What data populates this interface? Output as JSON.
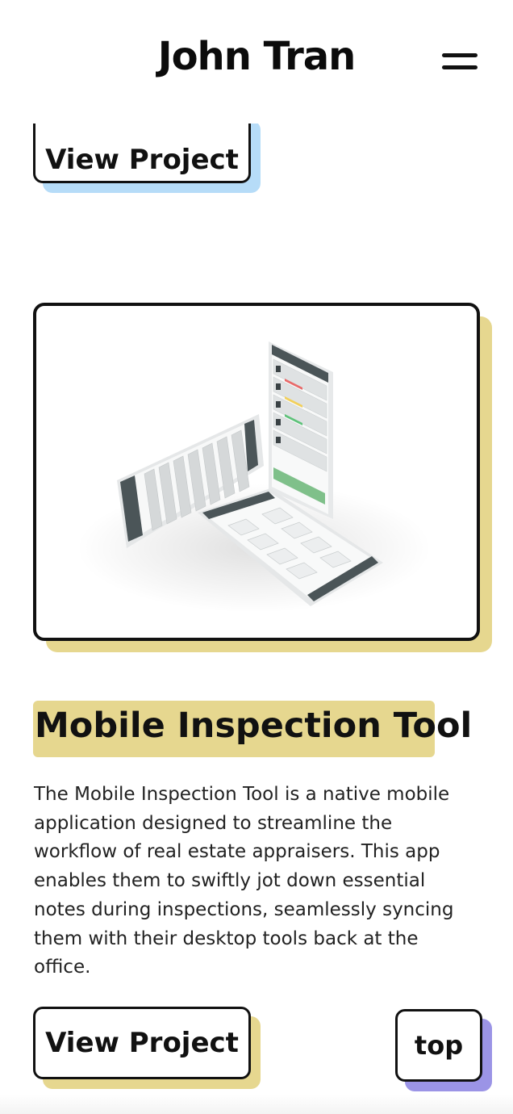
{
  "header": {
    "title": "John Tran",
    "menu_icon": "hamburger-menu-icon"
  },
  "previous_project": {
    "view_label": "View Project",
    "accent": "#b6dcf8"
  },
  "project": {
    "title": "Mobile Inspection Tool",
    "accent": "#e6d78f",
    "description": "The Mobile Inspection Tool is a native mobile application designed to streamline the workflow of real estate appraisers. This app enables them to swiftly jot down essential notes during inspections, seamlessly syncing them with their desktop tools back at the office.",
    "view_label": "View Project"
  },
  "scroll_top": {
    "label": "top",
    "accent": "#9b94e6"
  }
}
